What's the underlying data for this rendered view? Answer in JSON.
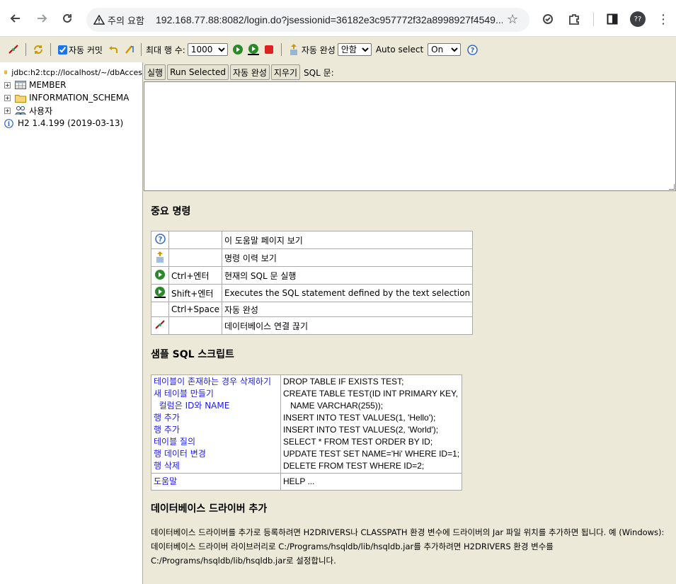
{
  "browser": {
    "security_label": "주의 요함",
    "url": "192.168.77.88:8082/login.do?jsessionid=36182e3c957772f32a8998927f4549...",
    "profile_label": "??"
  },
  "toolbar": {
    "autocommit_label": "자동 커밋",
    "autocommit_checked": true,
    "max_rows_label": "최대 행 수:",
    "max_rows_value": "1000",
    "autocomplete_label": "자동 완성",
    "autocomplete_value": "안함",
    "autoselect_label": "Auto select",
    "autoselect_value": "On"
  },
  "tree": {
    "connection": "jdbc:h2:tcp://localhost/~/dbAcces",
    "items": [
      {
        "label": "MEMBER"
      },
      {
        "label": "INFORMATION_SCHEMA"
      },
      {
        "label": "사용자"
      }
    ],
    "version": "H2 1.4.199 (2019-03-13)"
  },
  "query": {
    "run_label": "실행",
    "run_selected_label": "Run Selected",
    "autocomplete_label": "자동 완성",
    "clear_label": "지우기",
    "sql_label": "SQL 문:"
  },
  "important": {
    "heading": "중요 명령",
    "rows": [
      {
        "icon": "help-icon",
        "key": "",
        "desc": "이 도움말 페이지 보기"
      },
      {
        "icon": "history-icon",
        "key": "",
        "desc": "명령 이력 보기"
      },
      {
        "icon": "run-icon",
        "key": "Ctrl+엔터",
        "desc": "현재의 SQL 문 실행"
      },
      {
        "icon": "run-selected-icon",
        "key": "Shift+엔터",
        "desc": "Executes the SQL statement defined by the text selection"
      },
      {
        "icon": "",
        "key": "Ctrl+Space",
        "desc": "자동 완성"
      },
      {
        "icon": "disconnect-icon",
        "key": "",
        "desc": "데이터베이스 연결 끊기"
      }
    ]
  },
  "samples": {
    "heading": "샘플 SQL 스크립트",
    "links": [
      "테이블이 존재하는 경우 삭제하기",
      "새 테이블 만들기",
      "  컬럼은 ID와 NAME",
      "행 추가",
      "행 추가",
      "테이블 질의",
      "행 데이터 변경",
      "행 삭제"
    ],
    "code": [
      "DROP TABLE IF EXISTS TEST;",
      "CREATE TABLE TEST(ID INT PRIMARY KEY,",
      "   NAME VARCHAR(255));",
      "INSERT INTO TEST VALUES(1, 'Hello');",
      "INSERT INTO TEST VALUES(2, 'World');",
      "SELECT * FROM TEST ORDER BY ID;",
      "UPDATE TEST SET NAME='Hi' WHERE ID=1;",
      "DELETE FROM TEST WHERE ID=2;"
    ],
    "help_link": "도움말",
    "help_code": "HELP ..."
  },
  "drivers": {
    "heading": "데이터베이스 드라이버 추가",
    "text": "데이터베이스 드라이버를 추가로 등록하려면 H2DRIVERS나 CLASSPATH 환경 변수에 드라이버의 Jar 파일 위치를 추가하면 됩니다. 예 (Windows): 데이터베이스 드라이버 라이브러리로 C:/Programs/hsqldb/lib/hsqldb.jar를 추가하려면 H2DRIVERS 환경 변수를 C:/Programs/hsqldb/lib/hsqldb.jar로 설정합니다."
  }
}
